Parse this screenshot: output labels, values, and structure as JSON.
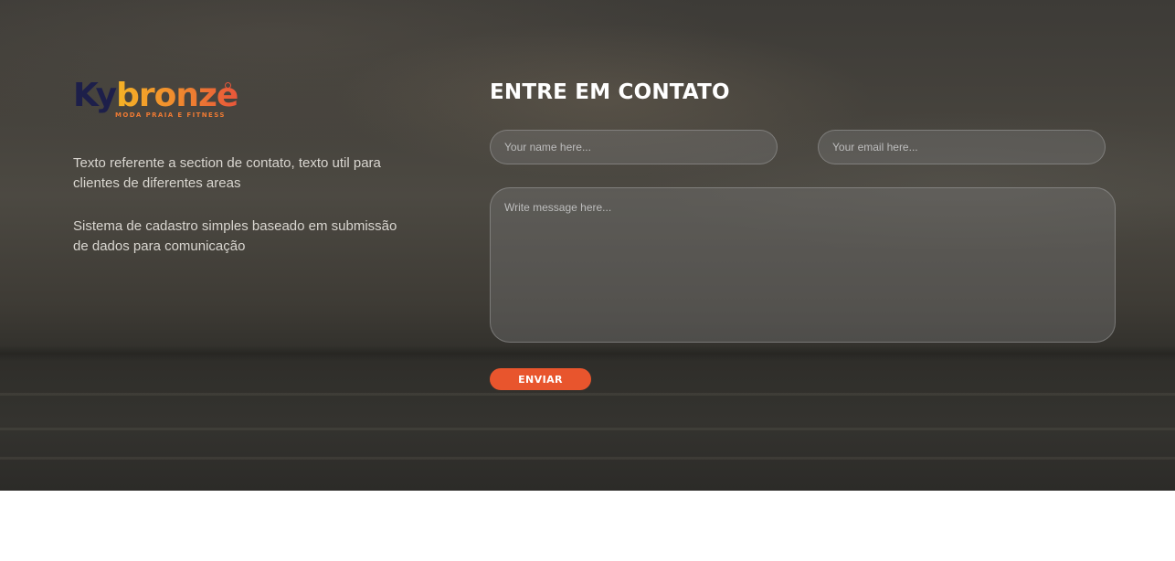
{
  "brand": {
    "logo_ky": "Ky",
    "logo_bronze": "bronze",
    "tagline": "MODA PRAIA E FITNESS"
  },
  "info": {
    "paragraph_1": "Texto referente a section de contato, texto util para clientes de diferentes areas",
    "paragraph_2": "Sistema de cadastro simples baseado em submissão de dados para comunicação"
  },
  "form": {
    "title": "ENTRE EM CONTATO",
    "name_placeholder": "Your name here...",
    "email_placeholder": "Your email here...",
    "message_placeholder": "Write message here...",
    "submit_label": "ENVIAR"
  },
  "colors": {
    "accent": "#e8552d",
    "logo_navy": "#1d1f4a",
    "logo_orange": "#f08a2e"
  }
}
